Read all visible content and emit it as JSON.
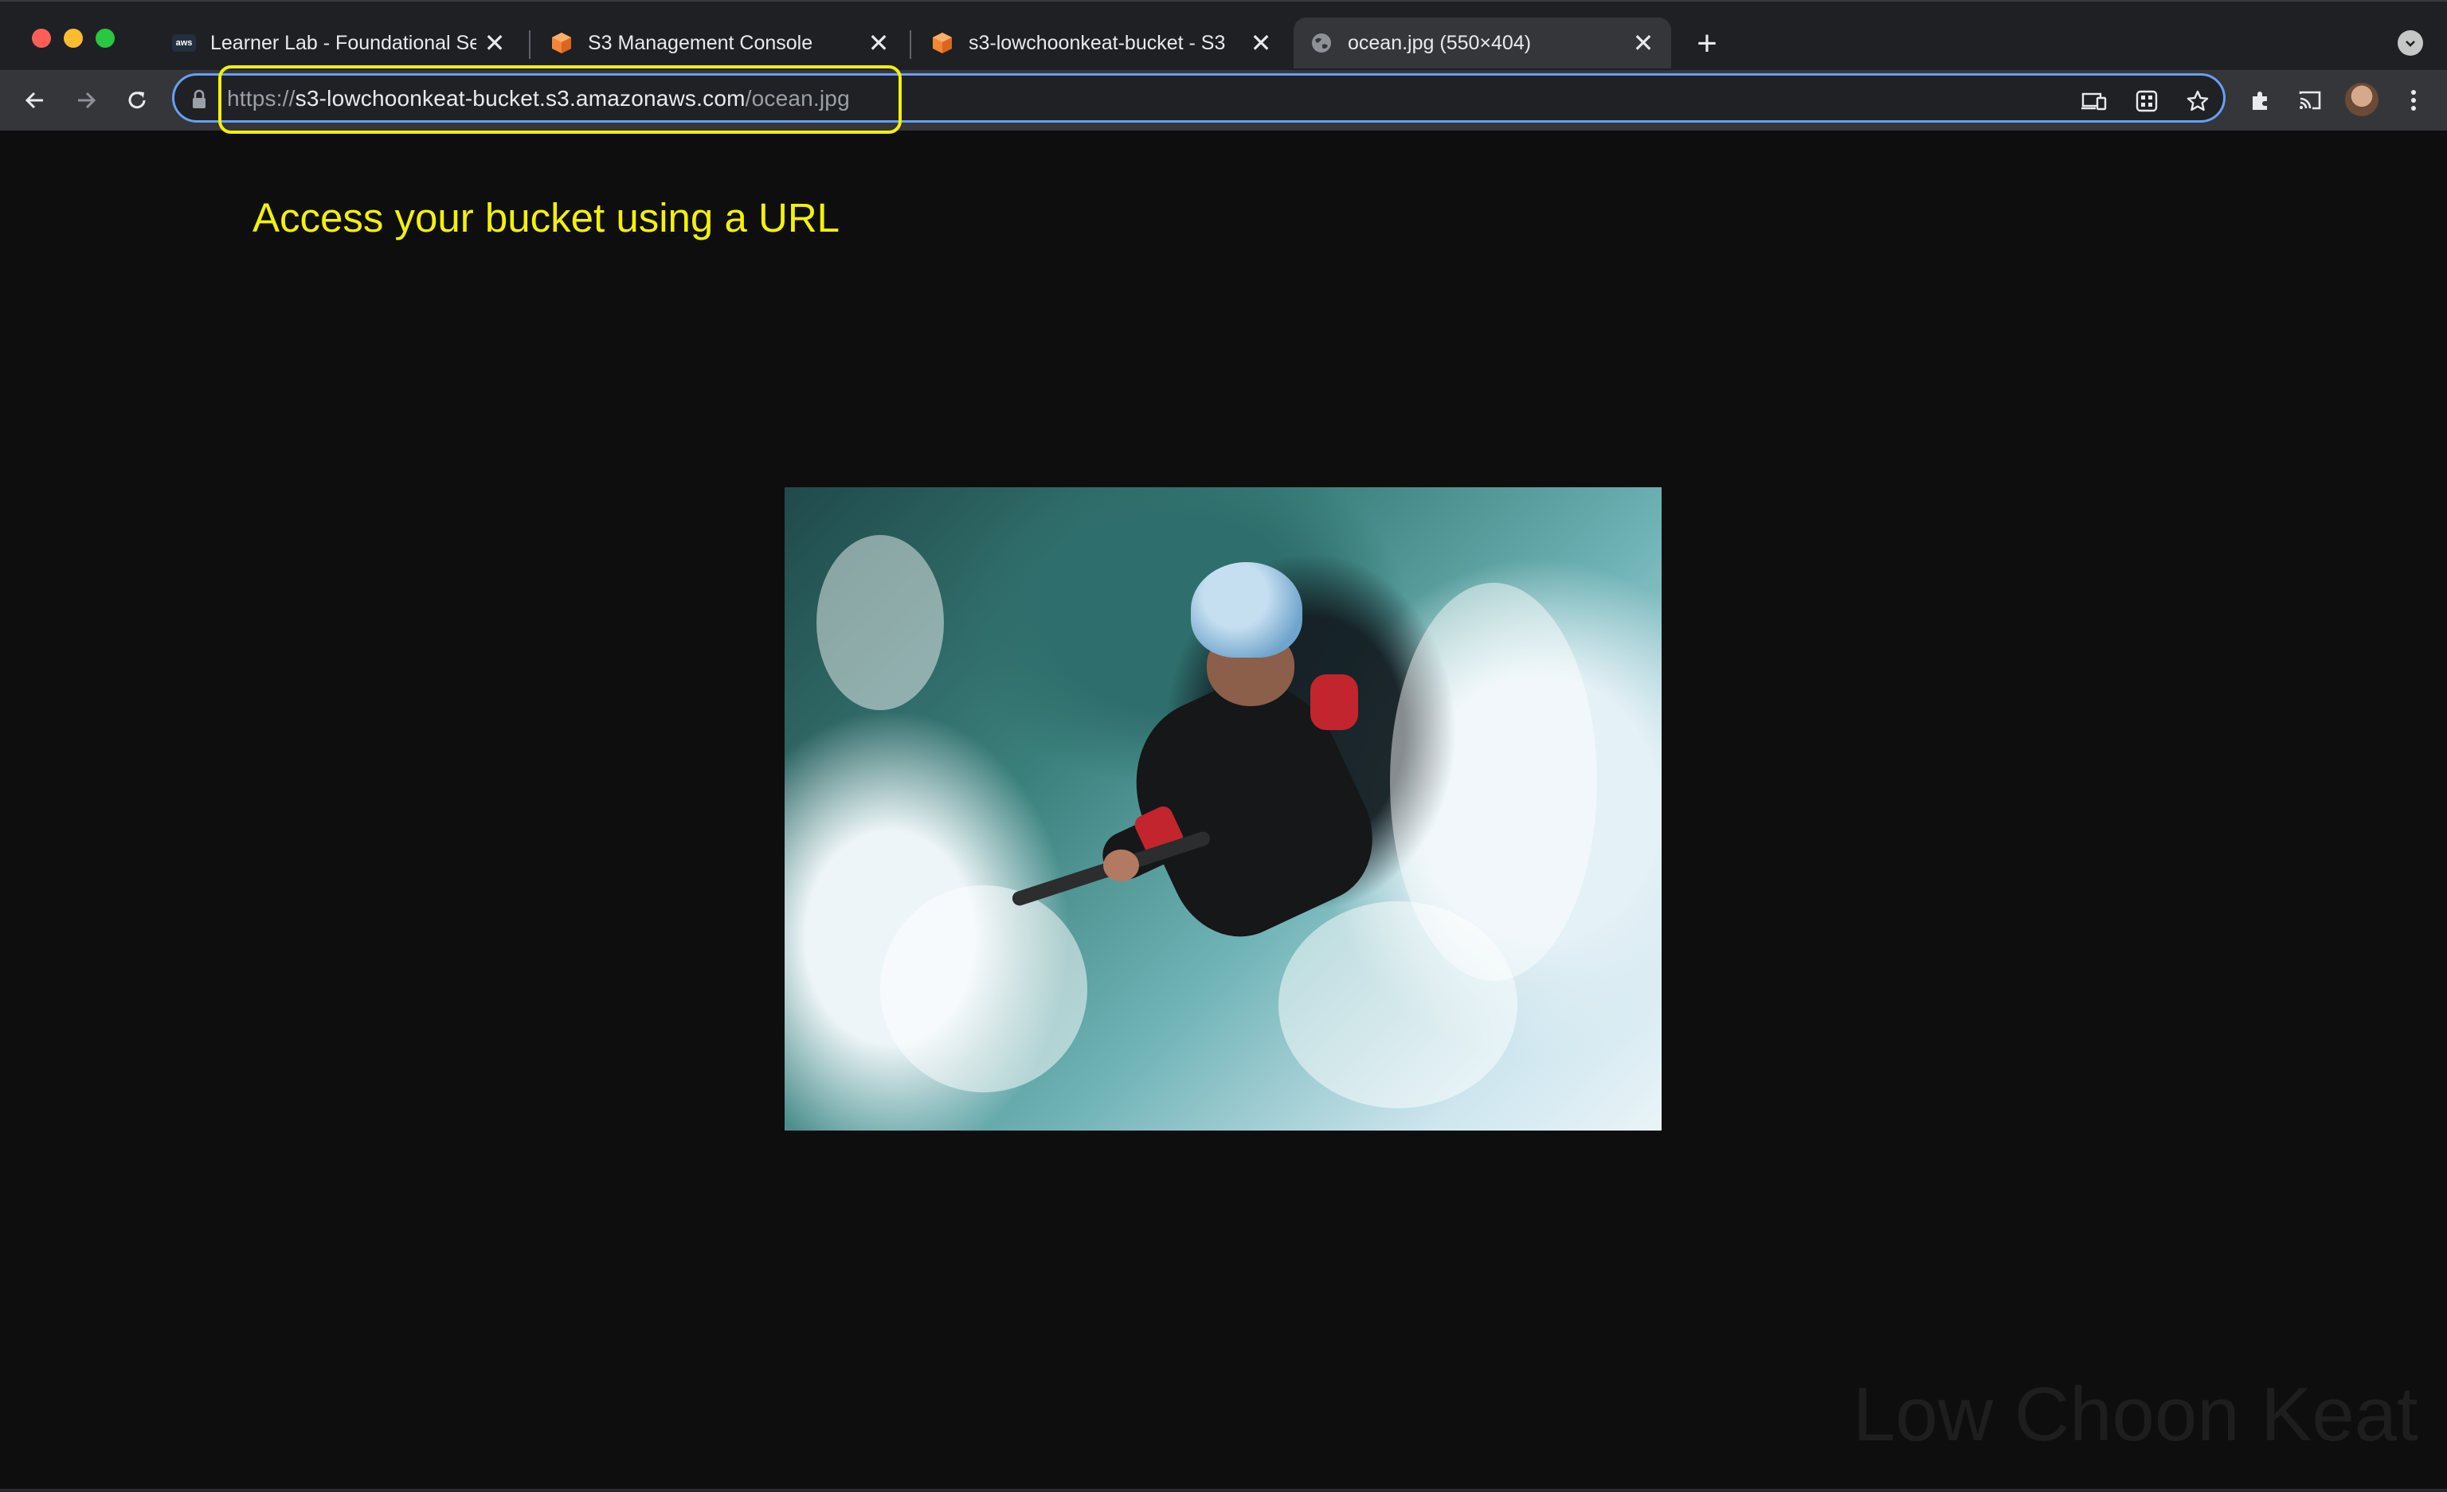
{
  "browser": {
    "tabs": [
      {
        "title": "Learner Lab - Foundational Ser",
        "favicon": "aws-icon",
        "active": false
      },
      {
        "title": "S3 Management Console",
        "favicon": "s3-cube-icon",
        "active": false
      },
      {
        "title": "s3-lowchoonkeat-bucket - S3",
        "favicon": "s3-cube-icon",
        "active": false
      },
      {
        "title": "ocean.jpg (550×404)",
        "favicon": "globe-icon",
        "active": true
      }
    ],
    "aws_favicon_text": "aws",
    "new_tab_label": "+",
    "close_glyph": "✕",
    "address": {
      "scheme": "https://",
      "host": "s3-lowchoonkeat-bucket.s3.amazonaws.com",
      "path": "/ocean.jpg"
    }
  },
  "page": {
    "annotation": "Access your bucket using a URL",
    "image_alt": "ocean.jpg",
    "watermark": "Low Choon Keat"
  },
  "colors": {
    "annotation": "#f2f204",
    "highlight_box": "#f2f204",
    "omnibox_focus": "#6a9ef3",
    "page_background": "#0e0e0e"
  }
}
